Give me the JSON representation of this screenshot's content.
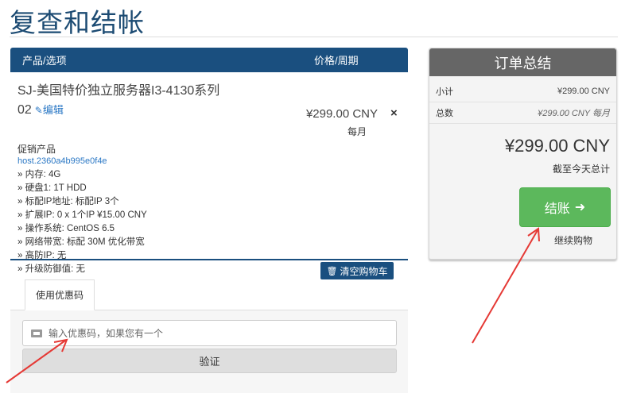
{
  "page": {
    "title": "复查和结帐"
  },
  "cart": {
    "headers": {
      "product": "产品/选项",
      "price": "价格/周期"
    },
    "item": {
      "name": "SJ-美国特价独立服务器I3-4130系列02",
      "edit_label": "编辑",
      "promo": "促销产品",
      "host": "host.2360a4b995e0f4e",
      "options": [
        "» 内存: 4G",
        "» 硬盘1: 1T HDD",
        "» 标配IP地址: 标配IP 3个",
        "» 扩展IP: 0 x 1个IP ¥15.00 CNY",
        "» 操作系统: CentOS 6.5",
        "» 网络带宽: 标配 30M 优化带宽",
        "» 高防IP: 无",
        "» 升级防御值: 无"
      ],
      "price": "¥299.00 CNY",
      "cycle": "每月",
      "remove_icon": "×"
    },
    "empty_label": "清空购物车"
  },
  "promo": {
    "tab_label": "使用优惠码",
    "placeholder": "输入优惠码，如果您有一个",
    "verify_label": "验证"
  },
  "summary": {
    "title": "订单总结",
    "subtotal_label": "小计",
    "subtotal_value": "¥299.00 CNY",
    "total_label": "总数",
    "total_value": "¥299.00 CNY 每月",
    "grand_total": "¥299.00 CNY",
    "due_label": "截至今天总计",
    "checkout_label": "结账",
    "continue_label": "继续购物"
  },
  "colors": {
    "navy": "#1a4f7f",
    "green": "#5cb85c",
    "annotation": "#e53935"
  }
}
